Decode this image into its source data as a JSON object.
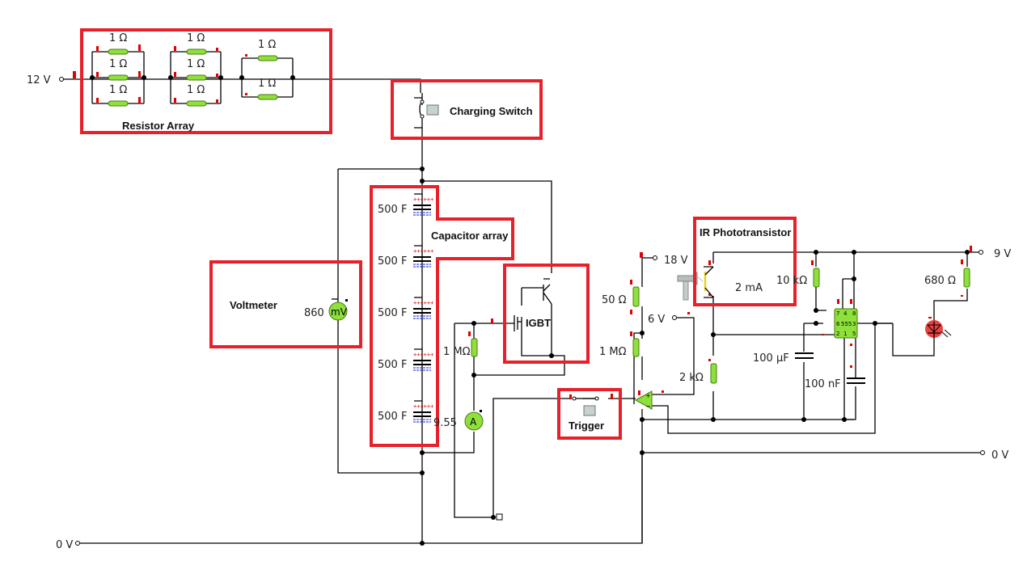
{
  "diagram": {
    "annotations": {
      "resistor_array": "Resistor Array",
      "charging_switch": "Charging Switch",
      "capacitor_array": "Capacitor array",
      "voltmeter": "Voltmeter",
      "igbt": "IGBT",
      "ir_phototransistor": "IR Phototransistor",
      "trigger": "Trigger"
    },
    "sources": {
      "v12": "12 V",
      "v18": "18 V",
      "v6": "6 V",
      "v9": "9 V",
      "gnd_left": "0 V",
      "gnd_right": "0 V"
    },
    "resistor_array": {
      "bank1": [
        "1 Ω",
        "1 Ω",
        "1 Ω"
      ],
      "bank2": [
        "1 Ω",
        "1 Ω",
        "1 Ω"
      ],
      "bank3": [
        "1 Ω",
        "1 Ω"
      ]
    },
    "capacitors": [
      "500 F",
      "500 F",
      "500 F",
      "500 F",
      "500 F"
    ],
    "meters": {
      "voltmeter_value": "860",
      "voltmeter_unit": "mV",
      "ammeter_value": "9.55",
      "ammeter_unit": "A",
      "photo_current": "2 mA"
    },
    "components": {
      "r_gate": "1 MΩ",
      "r_50": "50 Ω",
      "r_1m": "1 MΩ",
      "r_2k": "2 kΩ",
      "r_10k": "10 kΩ",
      "r_680": "680 Ω",
      "c_100u": "100 µF",
      "c_100n": "100 nF",
      "timer_ic": "555",
      "timer_pins": [
        "7",
        "4",
        "8",
        "6",
        "3",
        "2",
        "1",
        "5"
      ],
      "opamp_plus": "+",
      "opamp_minus": "−"
    }
  }
}
